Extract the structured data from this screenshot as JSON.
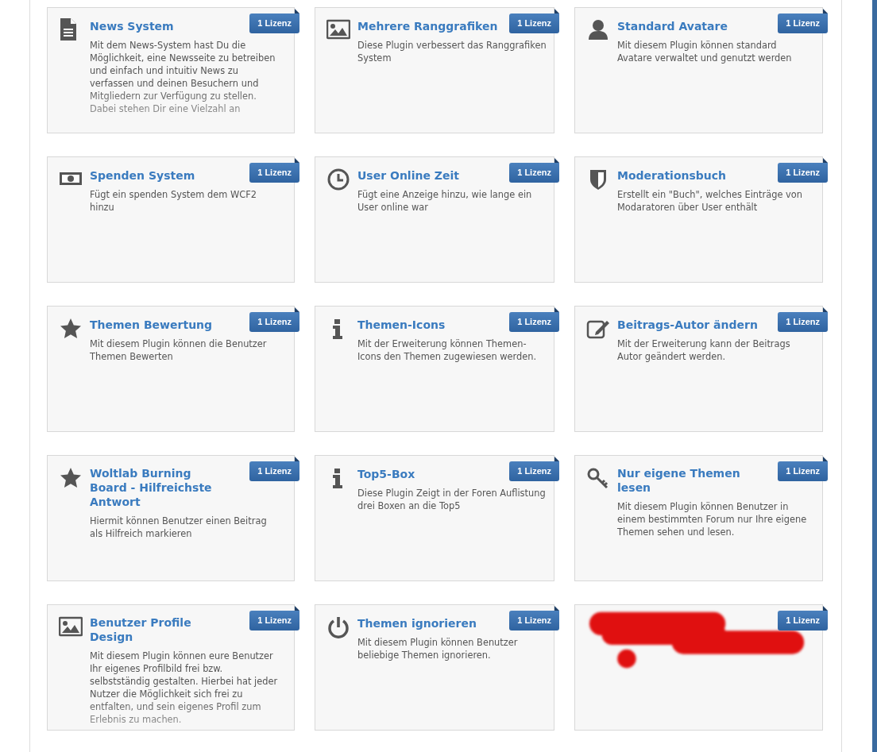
{
  "plugins": [
    {
      "kind": "document",
      "title": "News System",
      "badge": "1 Lizenz",
      "description": "Mit dem News-System hast Du die Möglichkeit, eine Newsseite zu betreiben und einfach und intuitiv News zu verfassen und deinen Besuchern und Mitgliedern zur Verfügung zu stellen. Dabei stehen Dir eine Vielzahl an",
      "faded": true
    },
    {
      "kind": "image",
      "title": "Mehrere Ranggrafiken",
      "badge": "1 Lizenz",
      "description": "Diese Plugin verbessert das Ranggrafiken System",
      "faded": false
    },
    {
      "kind": "user",
      "title": "Standard Avatare",
      "badge": "1 Lizenz",
      "description": "Mit diesem Plugin können standard Avatare verwaltet und genutzt werden",
      "faded": false
    },
    {
      "kind": "money",
      "title": "Spenden System",
      "badge": "1 Lizenz",
      "description": "Fügt ein spenden System dem WCF2 hinzu",
      "faded": false
    },
    {
      "kind": "clock",
      "title": "User Online Zeit",
      "badge": "1 Lizenz",
      "description": "Fügt eine Anzeige hinzu, wie lange ein User online war",
      "faded": false
    },
    {
      "kind": "shield",
      "title": "Moderationsbuch",
      "badge": "1 Lizenz",
      "description": "Erstellt ein \"Buch\", welches Einträge von Modaratoren über User enthält",
      "faded": false
    },
    {
      "kind": "star",
      "title": "Themen Bewertung",
      "badge": "1 Lizenz",
      "description": "Mit diesem Plugin können die Benutzer Themen Bewerten",
      "faded": false
    },
    {
      "kind": "info",
      "title": "Themen-Icons",
      "badge": "1 Lizenz",
      "description": "Mit der Erweiterung können Themen-Icons den Themen zugewiesen werden.",
      "faded": false
    },
    {
      "kind": "edit",
      "title": "Beitrags-Autor ändern",
      "badge": "1 Lizenz",
      "description": "Mit der Erweiterung kann der Beitrags Autor geändert werden.",
      "faded": false
    },
    {
      "kind": "star",
      "title": "Woltlab Burning Board - Hilfreichste Antwort",
      "badge": "1 Lizenz",
      "description": "Hiermit können Benutzer einen Beitrag als Hilfreich markieren",
      "faded": false
    },
    {
      "kind": "info",
      "title": "Top5-Box",
      "badge": "1 Lizenz",
      "description": "Diese Plugin Zeigt in der Foren Auflistung drei Boxen an die Top5",
      "faded": false
    },
    {
      "kind": "key",
      "title": "Nur eigene Themen lesen",
      "badge": "1 Lizenz",
      "description": "Mit diesem Plugin können Benutzer in einem bestimmten Forum nur Ihre eigene Themen sehen und lesen.",
      "faded": false
    },
    {
      "kind": "image",
      "title": "Benutzer Profile Design",
      "badge": "1 Lizenz",
      "description": "Mit diesem Plugin können eure Benutzer Ihr eigenes Profilbild frei bzw. selbstständig gestalten. Hierbei hat jeder Nutzer die Möglichkeit sich frei zu entfalten, und sein eigenes Profil zum Erlebnis zu machen.",
      "faded": true
    },
    {
      "kind": "power",
      "title": "Themen ignorieren",
      "badge": "1 Lizenz",
      "description": "Mit diesem Plugin können Benutzer beliebige Themen ignorieren.",
      "faded": false
    },
    {
      "kind": "redacted",
      "badge": "1 Lizenz",
      "redacted": true
    }
  ]
}
